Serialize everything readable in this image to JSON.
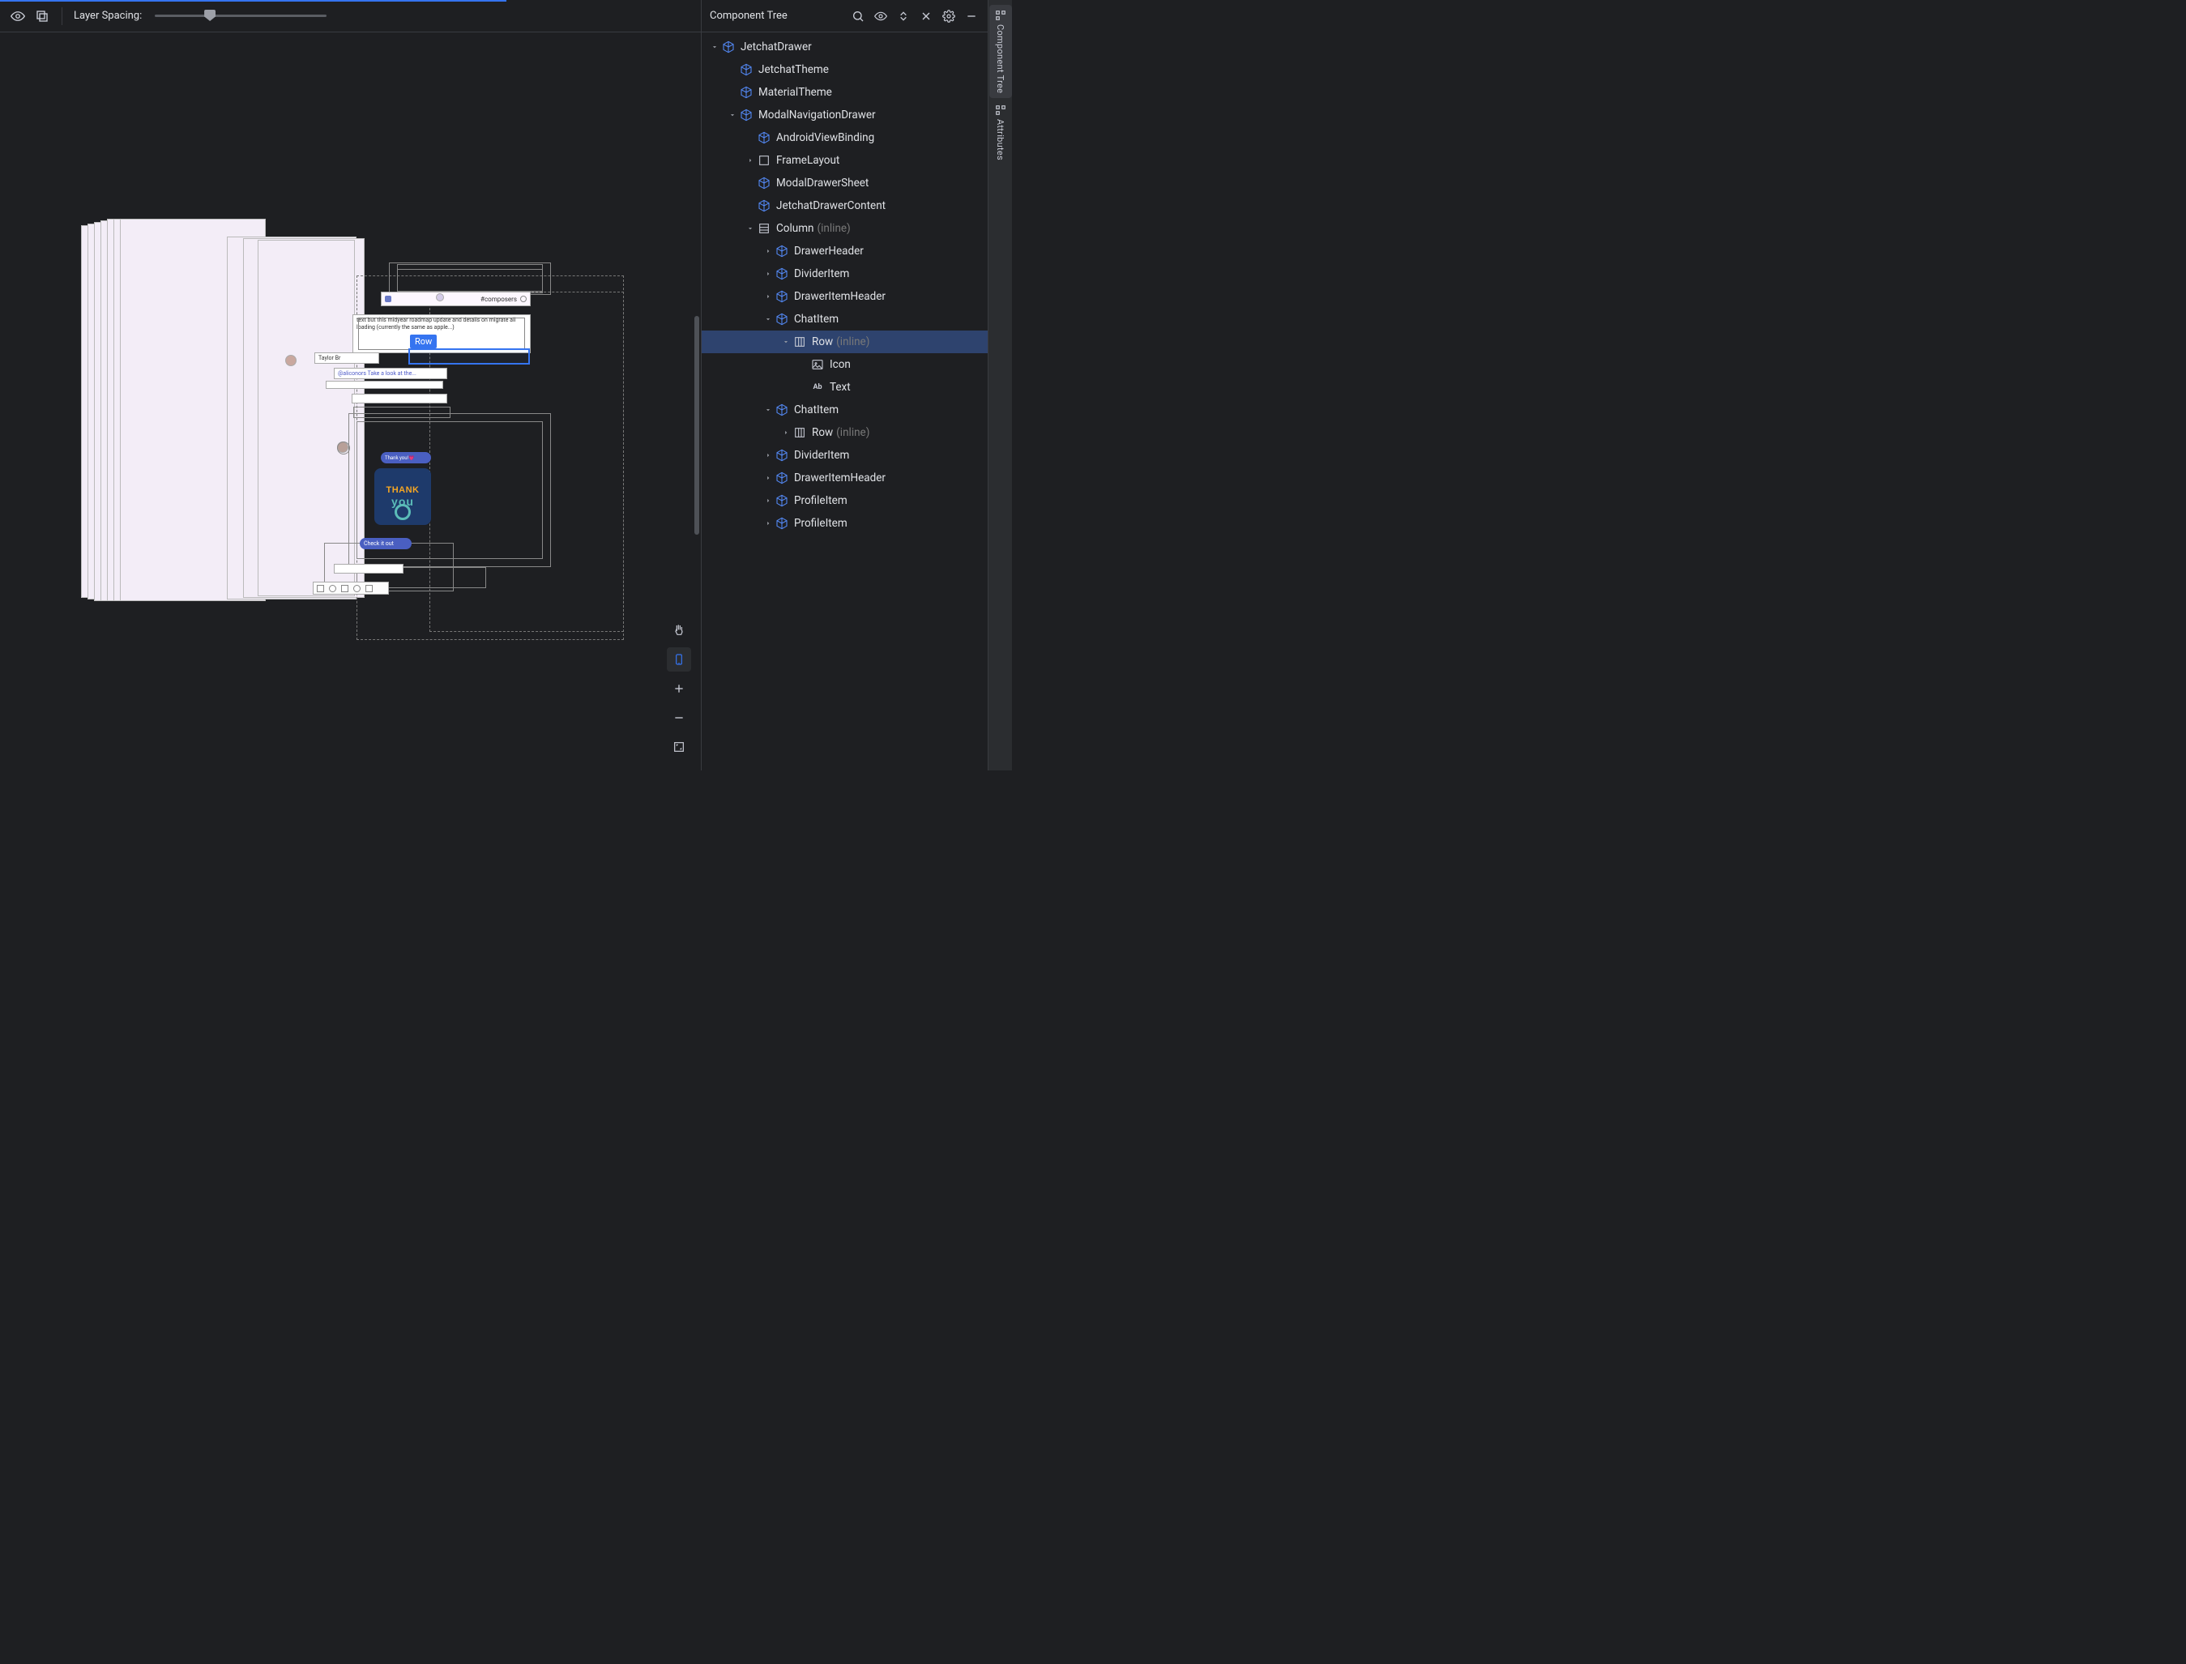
{
  "progress_width": 625,
  "toolbar": {
    "layer_spacing_label": "Layer Spacing:",
    "slider_percent": 32
  },
  "viz": {
    "selection_label": "Row",
    "header_channel": "#composers",
    "author_name": "Taylor Br",
    "mention_text": "@aliconors Take a look at the...",
    "thank_you_text": "Thank you!",
    "thank_line1": "THANK",
    "thank_line2": "you",
    "check_it": "Check it out",
    "body_text": "text but this midyear roadmap update and details on migrate all loading (currently the same as apple...)"
  },
  "float_tools": {
    "pan": "pan",
    "device": "device",
    "zoom_in": "+",
    "zoom_out": "−",
    "fit": "fit"
  },
  "side": {
    "title": "Component Tree"
  },
  "tree": [
    {
      "depth": 0,
      "chev": "down",
      "icon": "cube",
      "label": "JetchatDrawer"
    },
    {
      "depth": 1,
      "chev": "none",
      "icon": "cube",
      "label": "JetchatTheme"
    },
    {
      "depth": 1,
      "chev": "none",
      "icon": "cube",
      "label": "MaterialTheme"
    },
    {
      "depth": 1,
      "chev": "down",
      "icon": "cube",
      "label": "ModalNavigationDrawer"
    },
    {
      "depth": 2,
      "chev": "none",
      "icon": "cube",
      "label": "AndroidViewBinding"
    },
    {
      "depth": 2,
      "chev": "right",
      "icon": "box",
      "label": "FrameLayout"
    },
    {
      "depth": 2,
      "chev": "none",
      "icon": "cube",
      "label": "ModalDrawerSheet"
    },
    {
      "depth": 2,
      "chev": "none",
      "icon": "cube",
      "label": "JetchatDrawerContent"
    },
    {
      "depth": 2,
      "chev": "down",
      "icon": "col",
      "label": "Column",
      "suffix": "(inline)"
    },
    {
      "depth": 3,
      "chev": "right",
      "icon": "cube",
      "label": "DrawerHeader",
      "guide": true
    },
    {
      "depth": 3,
      "chev": "right",
      "icon": "cube",
      "label": "DividerItem",
      "guide": true
    },
    {
      "depth": 3,
      "chev": "right",
      "icon": "cube",
      "label": "DrawerItemHeader",
      "guide": true
    },
    {
      "depth": 3,
      "chev": "down",
      "icon": "cube",
      "label": "ChatItem",
      "guide": true
    },
    {
      "depth": 4,
      "chev": "down",
      "icon": "row",
      "label": "Row",
      "suffix": "(inline)",
      "selected": true,
      "guide": true
    },
    {
      "depth": 5,
      "chev": "none",
      "icon": "img",
      "label": "Icon",
      "guide": true,
      "guide_h": true
    },
    {
      "depth": 5,
      "chev": "none",
      "icon": "txt",
      "label": "Text",
      "guide": true,
      "guide_h": true,
      "last": true
    },
    {
      "depth": 3,
      "chev": "down",
      "icon": "cube",
      "label": "ChatItem",
      "guide": true
    },
    {
      "depth": 4,
      "chev": "right",
      "icon": "row",
      "label": "Row",
      "suffix": "(inline)",
      "guide": true
    },
    {
      "depth": 3,
      "chev": "right",
      "icon": "cube",
      "label": "DividerItem",
      "guide": true
    },
    {
      "depth": 3,
      "chev": "right",
      "icon": "cube",
      "label": "DrawerItemHeader",
      "guide": true
    },
    {
      "depth": 3,
      "chev": "right",
      "icon": "cube",
      "label": "ProfileItem",
      "guide": true
    },
    {
      "depth": 3,
      "chev": "right",
      "icon": "cube",
      "label": "ProfileItem",
      "guide": true,
      "last": true
    }
  ],
  "rail": {
    "tree_label": "Component Tree",
    "attrs_label": "Attributes"
  }
}
